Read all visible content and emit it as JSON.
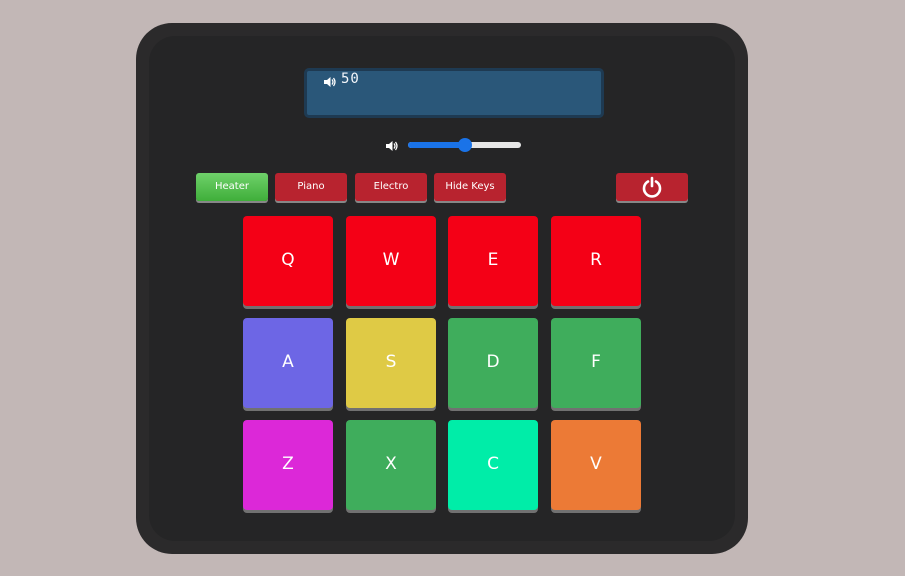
{
  "display": {
    "volume_icon": "speaker-icon",
    "text": "50"
  },
  "volume": {
    "icon": "speaker-icon",
    "value": 50,
    "min": 0,
    "max": 100,
    "accent": "#1a73e8"
  },
  "buttons": [
    {
      "label": "Heater",
      "color": "#4cbf46",
      "active": true
    },
    {
      "label": "Piano",
      "color": "#b8232f",
      "active": false
    },
    {
      "label": "Electro",
      "color": "#b8232f",
      "active": false
    },
    {
      "label": "Hide Keys",
      "color": "#b8232f",
      "active": false
    }
  ],
  "power": {
    "icon": "power-icon",
    "color": "#b8232f"
  },
  "pads": [
    {
      "key": "Q",
      "color": "#f40016"
    },
    {
      "key": "W",
      "color": "#f40016"
    },
    {
      "key": "E",
      "color": "#f40016"
    },
    {
      "key": "R",
      "color": "#f40016"
    },
    {
      "key": "A",
      "color": "#6d66e5"
    },
    {
      "key": "S",
      "color": "#dfca45"
    },
    {
      "key": "D",
      "color": "#3fad5c"
    },
    {
      "key": "F",
      "color": "#3fad5c"
    },
    {
      "key": "Z",
      "color": "#dc28d8"
    },
    {
      "key": "X",
      "color": "#3fad5c"
    },
    {
      "key": "C",
      "color": "#00eda8"
    },
    {
      "key": "V",
      "color": "#ec7a36"
    }
  ]
}
